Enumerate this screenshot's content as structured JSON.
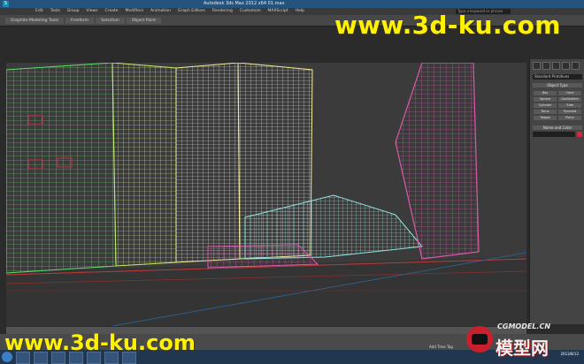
{
  "window": {
    "title": "Autodesk 3ds Max 2012 x64     01.max"
  },
  "menubar": {
    "items": [
      "Edit",
      "Tools",
      "Group",
      "Views",
      "Create",
      "Modifiers",
      "Animation",
      "Graph Editors",
      "Rendering",
      "Customize",
      "MAXScript",
      "Help"
    ],
    "search_placeholder": "Type a keyword or phrase"
  },
  "ribbon": {
    "tabs": [
      "Graphite Modeling Tools",
      "Freeform",
      "Selection",
      "Object Paint"
    ]
  },
  "command_panel": {
    "dropdown": "Standard Primitives",
    "rollout_object_type": "Object Type",
    "buttons": [
      "Box",
      "Cone",
      "Sphere",
      "GeoSphere",
      "Cylinder",
      "Tube",
      "Torus",
      "Pyramid",
      "Teapot",
      "Plane"
    ],
    "rollout_name_color": "Name and Color",
    "color_swatch": "#d02a3c"
  },
  "status": {
    "add_time_tag": "Add Time Tag"
  },
  "taskbar": {
    "clock": "2013/8/12"
  },
  "watermarks": {
    "top": "www.3d-ku.com",
    "bottom": "www.3d-ku.com",
    "cgmodel": "CGMODEL.CN",
    "cn": "模型网"
  }
}
